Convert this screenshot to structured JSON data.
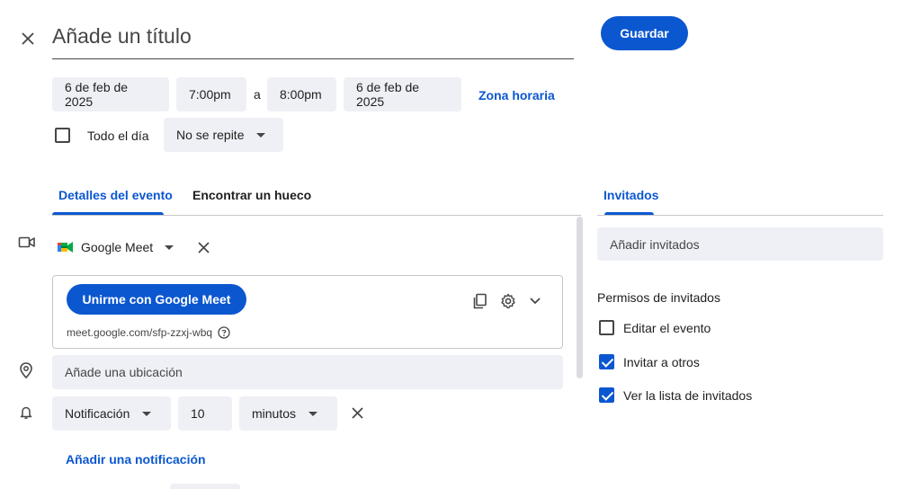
{
  "header": {
    "title_placeholder": "Añade un título",
    "save_label": "Guardar"
  },
  "datetime": {
    "start_date": "6 de feb de 2025",
    "start_time": "7:00pm",
    "separator": "a",
    "end_time": "8:00pm",
    "end_date": "6 de feb de 2025",
    "timezone_label": "Zona horaria",
    "all_day_label": "Todo el día",
    "all_day_checked": false,
    "repeat_value": "No se repite"
  },
  "tabs": {
    "details": "Detalles del evento",
    "find_time": "Encontrar un hueco",
    "guests": "Invitados"
  },
  "meet": {
    "provider": "Google Meet",
    "join_label": "Unirme con Google Meet",
    "link": "meet.google.com/sfp-zzxj-wbq"
  },
  "location": {
    "placeholder": "Añade una ubicación"
  },
  "notification": {
    "type": "Notificación",
    "amount": "10",
    "unit": "minutos",
    "add_label": "Añadir una notificación"
  },
  "guests": {
    "add_placeholder": "Añadir invitados",
    "permissions_title": "Permisos de invitados",
    "permissions": [
      {
        "label": "Editar el evento",
        "checked": false
      },
      {
        "label": "Invitar a otros",
        "checked": true
      },
      {
        "label": "Ver la lista de invitados",
        "checked": true
      }
    ]
  },
  "colors": {
    "accent": "#0b57d0",
    "chip_bg": "#eef0f5",
    "text": "#1f1f1f"
  }
}
